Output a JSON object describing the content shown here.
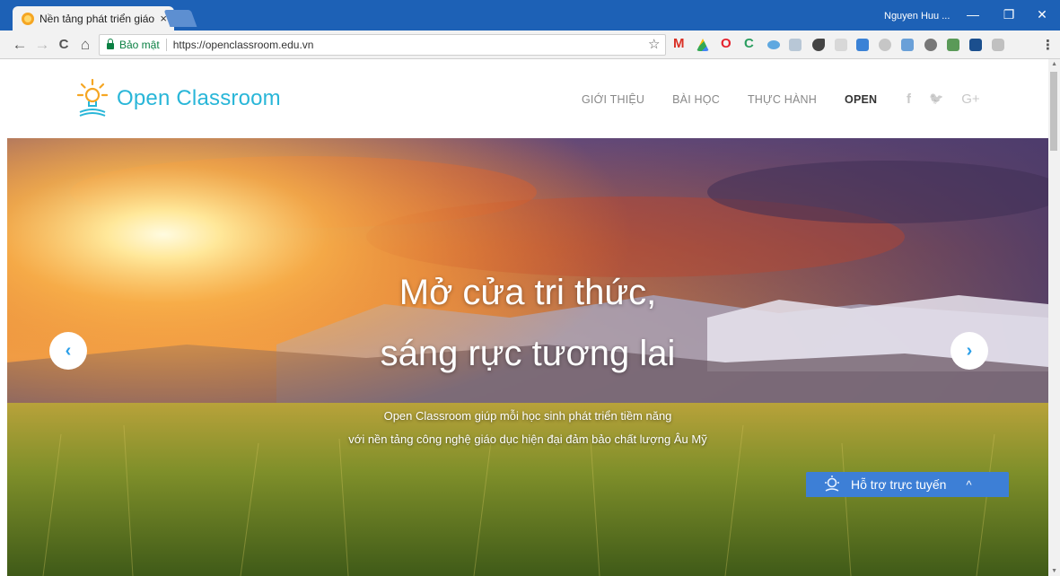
{
  "browser": {
    "tab_title": "Nền tảng phát triển giáo",
    "tab_close": "×",
    "profile_name": "Nguyen Huu ...",
    "window_controls": {
      "minimize": "—",
      "restore": "❐",
      "close": "✕"
    },
    "nav": {
      "back": "←",
      "forward": "→",
      "reload": "C",
      "home": "⌂"
    },
    "secure_label": "Bảo mật",
    "url": "https://openclassroom.edu.vn",
    "bookmark_icon": "☆",
    "menu_icon": "⋮",
    "extensions": [
      {
        "name": "gmail-icon",
        "glyph": "M",
        "color": "#d93025"
      },
      {
        "name": "drive-icon",
        "color": "#fbbc05"
      },
      {
        "name": "opera-icon",
        "glyph": "O",
        "color": "#e5212d"
      },
      {
        "name": "coccoc-icon",
        "glyph": "C",
        "color": "#2a9d5f"
      },
      {
        "name": "weather-icon",
        "color": "#5fa8e0"
      },
      {
        "name": "dropbox-icon",
        "color": "#b8c7d6"
      },
      {
        "name": "comet-icon",
        "color": "#444444"
      },
      {
        "name": "translate-icon",
        "color": "#a0a0a0"
      },
      {
        "name": "expand-icon",
        "color": "#3b82d6"
      },
      {
        "name": "cloud-icon",
        "color": "#b0b0b0"
      },
      {
        "name": "puzzle-icon",
        "color": "#6aa0d8"
      },
      {
        "name": "gear-ext-icon",
        "color": "#666666"
      },
      {
        "name": "screen-icon",
        "color": "#5a9a58"
      },
      {
        "name": "square-icon",
        "color": "#1b4f8e"
      },
      {
        "name": "skype-icon",
        "color": "#c0c0c0"
      }
    ]
  },
  "site": {
    "logo_text": "Open Classroom",
    "nav_links": [
      "GIỚI THIỆU",
      "BÀI HỌC",
      "THỰC HÀNH",
      "OPEN"
    ],
    "active_nav": "OPEN",
    "social": [
      "f",
      "🐦",
      "G+"
    ]
  },
  "hero": {
    "headline_line1": "Mở cửa tri thức,",
    "headline_line2": "sáng rực tương lai",
    "sub_line1": "Open Classroom giúp mỗi học sinh phát triển tiềm năng",
    "sub_line2": "với nền tảng công nghệ giáo dục hiện đại đảm bảo chất lượng Âu Mỹ",
    "prev_arrow": "‹",
    "next_arrow": "›"
  },
  "support_widget": {
    "label": "Hỗ trợ trực tuyến",
    "chevron": "^"
  },
  "colors": {
    "titlebar": "#1d61b6",
    "logo": "#29b6d8",
    "support": "#3d7fd6",
    "secure": "#0b8043"
  }
}
